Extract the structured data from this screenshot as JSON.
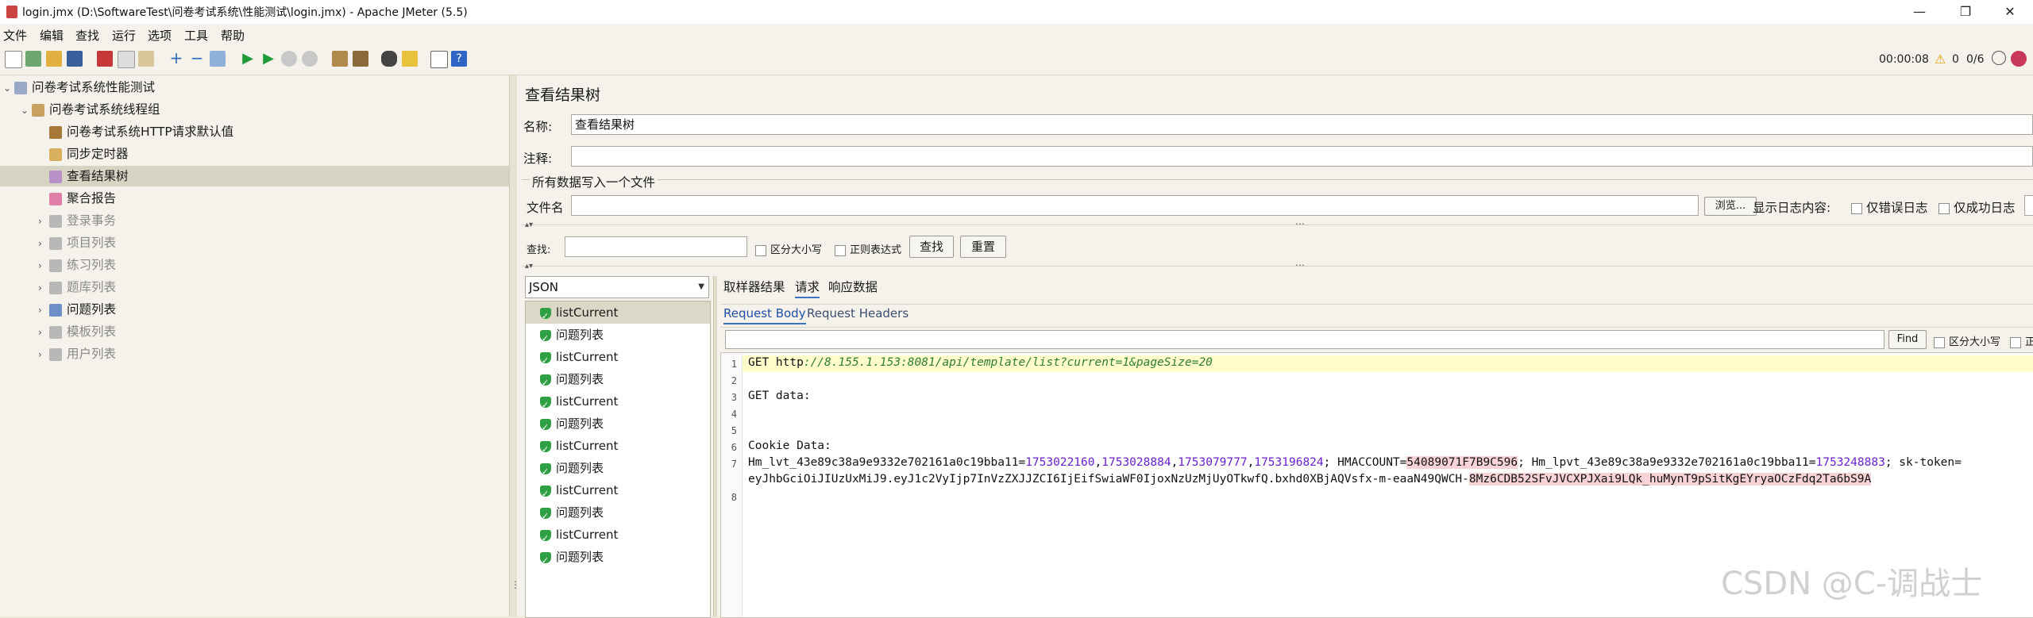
{
  "window": {
    "title": "login.jmx (D:\\SoftwareTest\\问卷考试系统\\性能测试\\login.jmx) - Apache JMeter (5.5)",
    "minimize": "—",
    "maximize": "❐",
    "close": "✕"
  },
  "menu": [
    "文件",
    "编辑",
    "查找",
    "运行",
    "选项",
    "工具",
    "帮助"
  ],
  "toolbar": {
    "icons": [
      "new-icon",
      "templates-icon",
      "open-icon",
      "save-icon",
      "cut-icon",
      "copy-icon",
      "paste-icon",
      "expand-icon",
      "collapse-icon",
      "toggle-icon",
      "start-icon",
      "start-no-pause-icon",
      "stop-icon",
      "shutdown-icon",
      "clear-icon",
      "clear-all-icon",
      "search-icon",
      "reset-search-icon",
      "function-helper-icon",
      "help-icon"
    ],
    "elapsed": "00:00:08",
    "warnings": "0",
    "threads": "0/6"
  },
  "tree": [
    {
      "label": "问卷考试系统性能测试",
      "level": 0,
      "arrow": "⌄",
      "icon": "test-plan-icon",
      "dim": false
    },
    {
      "label": "问卷考试系统线程组",
      "level": 1,
      "arrow": "⌄",
      "icon": "thread-group-icon",
      "dim": false
    },
    {
      "label": "问卷考试系统HTTP请求默认值",
      "level": 2,
      "arrow": "",
      "icon": "config-element-icon",
      "dim": false
    },
    {
      "label": "同步定时器",
      "level": 2,
      "arrow": "",
      "icon": "timer-icon",
      "dim": false
    },
    {
      "label": "查看结果树",
      "level": 2,
      "arrow": "",
      "icon": "listener-icon",
      "dim": false,
      "selected": true
    },
    {
      "label": "聚合报告",
      "level": 2,
      "arrow": "",
      "icon": "report-icon",
      "dim": false
    },
    {
      "label": "登录事务",
      "level": 2,
      "arrow": "›",
      "icon": "transaction-icon",
      "dim": true
    },
    {
      "label": "项目列表",
      "level": 2,
      "arrow": "›",
      "icon": "transaction-icon",
      "dim": true
    },
    {
      "label": "练习列表",
      "level": 2,
      "arrow": "›",
      "icon": "transaction-icon",
      "dim": true
    },
    {
      "label": "题库列表",
      "level": 2,
      "arrow": "›",
      "icon": "transaction-icon",
      "dim": true
    },
    {
      "label": "问题列表",
      "level": 2,
      "arrow": "›",
      "icon": "loop-icon",
      "dim": false
    },
    {
      "label": "模板列表",
      "level": 2,
      "arrow": "›",
      "icon": "transaction-icon",
      "dim": true
    },
    {
      "label": "用户列表",
      "level": 2,
      "arrow": "›",
      "icon": "transaction-icon",
      "dim": true
    }
  ],
  "panel": {
    "heading": "查看结果树",
    "name_label": "名称:",
    "name_value": "查看结果树",
    "comment_label": "注释:",
    "comment_value": "",
    "file_group": "所有数据写入一个文件",
    "file_label": "文件名",
    "browse": "浏览...",
    "log_label": "显示日志内容:",
    "errors_only": "仅错误日志",
    "success_only": "仅成功日志",
    "search_label": "查找:",
    "case_sensitive": "区分大小写",
    "regex": "正则表达式",
    "search_button": "查找",
    "reset_button": "重置"
  },
  "results": {
    "renderer": "JSON",
    "items": [
      "listCurrent",
      "问题列表",
      "listCurrent",
      "问题列表",
      "listCurrent",
      "问题列表",
      "listCurrent",
      "问题列表",
      "listCurrent",
      "问题列表",
      "listCurrent",
      "问题列表"
    ],
    "tabs": [
      "取样器结果",
      "请求",
      "响应数据"
    ],
    "active_tab": "请求",
    "subtabs": [
      "Request Body",
      "Request Headers"
    ],
    "active_subtab": "Request Body",
    "find_button": "Find",
    "find_case": "区分大小写",
    "find_regex": "正"
  },
  "code": {
    "line_numbers": [
      "1",
      "2",
      "3",
      "4",
      "5",
      "6",
      "7",
      "",
      "8"
    ],
    "l1_prefix": "GET http",
    "l1_url": "://8.155.1.153:8081/api/template/list?current=1&pageSize=20",
    "l3": "GET data:",
    "l6": "Cookie Data:",
    "l7a_1": "Hm_lvt_43e89c38a9e9332e702161a0c19bba11=",
    "l7a_n1": "1753022160",
    "l7a_c1": ",",
    "l7a_n2": "1753028884",
    "l7a_c2": ",",
    "l7a_n3": "1753079777",
    "l7a_c3": ",",
    "l7a_n4": "1753196824",
    "l7a_2": "; HMACCOUNT=",
    "l7a_hl": "54089071F7B9C596",
    "l7a_3": "; Hm_lpvt_43e89c38a9e9332e702161a0c19bba11=",
    "l7a_n5": "1753248883",
    "l7a_4": "; sk-token=",
    "l7b_1": "eyJhbGciOiJIUzUxMiJ9.eyJ1c2VyIjp7InVzZXJJZCI6IjEifSwiaWF0IjoxNzUzMjUyOTkwfQ.bxhd0XBjAQVsfx-m-eaaN49QWCH-",
    "l7b_hl": "8Mz6CDB52SFvJVCXPJXai9LQk_huMynT9pSitKgEYryaOCzFdq2Ta6bS9A"
  },
  "watermark": "CSDN @C-调战士"
}
